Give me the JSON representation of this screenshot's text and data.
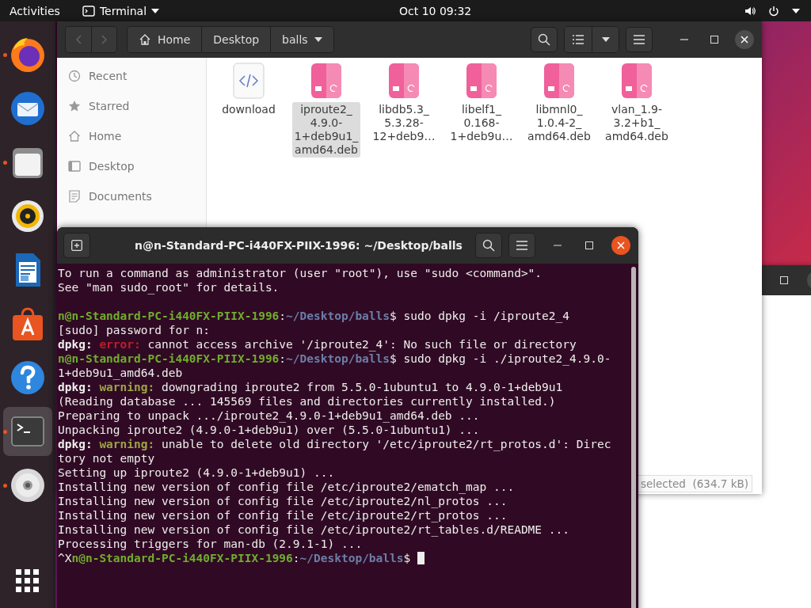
{
  "top_bar": {
    "activities": "Activities",
    "app_menu": "Terminal",
    "clock": "Oct 10  09:32"
  },
  "dock": {
    "items": [
      {
        "kind": "browser",
        "running": true,
        "active": false
      },
      {
        "kind": "mail",
        "running": false,
        "active": false
      },
      {
        "kind": "files",
        "running": true,
        "active": false
      },
      {
        "kind": "music",
        "running": false,
        "active": false
      },
      {
        "kind": "document",
        "running": false,
        "active": false
      },
      {
        "kind": "store",
        "running": false,
        "active": false
      },
      {
        "kind": "help",
        "running": false,
        "active": false
      },
      {
        "kind": "terminal",
        "running": true,
        "active": true
      },
      {
        "kind": "disc",
        "running": true,
        "active": false
      }
    ]
  },
  "files_window": {
    "nav": {
      "back_disabled": true,
      "forward_disabled": true
    },
    "path": [
      {
        "label": "Home",
        "kind": "home",
        "dropdown": false
      },
      {
        "label": "Desktop",
        "kind": "folder",
        "dropdown": false
      },
      {
        "label": "balls",
        "kind": "folder",
        "dropdown": true
      }
    ],
    "sidebar": [
      {
        "label": "Recent",
        "kind": "recent"
      },
      {
        "label": "Starred",
        "kind": "starred"
      },
      {
        "label": "Home",
        "kind": "home"
      },
      {
        "label": "Desktop",
        "kind": "desktop"
      },
      {
        "label": "Documents",
        "kind": "documents"
      }
    ],
    "files": [
      {
        "name": "download",
        "kind": "html",
        "selected": false
      },
      {
        "name": "iproute2_\n4.9.0-\n1+deb9u1_\namd64.deb",
        "kind": "deb",
        "selected": true
      },
      {
        "name": "libdb5.3_\n5.3.28-\n12+deb9…",
        "kind": "deb",
        "selected": false
      },
      {
        "name": "libelf1_\n0.168-\n1+deb9u…",
        "kind": "deb",
        "selected": false
      },
      {
        "name": "libmnl0_\n1.0.4-2_\namd64.deb",
        "kind": "deb",
        "selected": false
      },
      {
        "name": "vlan_1.9-\n3.2+b1_\namd64.deb",
        "kind": "deb",
        "selected": false
      }
    ],
    "status": "selected  (634.7 kB)"
  },
  "terminal_window": {
    "title": "n@n-Standard-PC-i440FX-PIIX-1996: ~/Desktop/balls",
    "cursor": true,
    "lines": [
      {
        "kind": "text",
        "segments": [
          {
            "kind": "plain",
            "text": "To run a command as administrator (user \"root\"), use \"sudo <command>\"."
          }
        ]
      },
      {
        "kind": "text",
        "segments": [
          {
            "kind": "plain",
            "text": "See \"man sudo_root\" for details."
          }
        ]
      },
      {
        "kind": "blank"
      },
      {
        "kind": "text",
        "segments": [
          {
            "kind": "prompt",
            "text": "n@n-Standard-PC-i440FX-PIIX-1996"
          },
          {
            "kind": "plain",
            "text": ":"
          },
          {
            "kind": "path",
            "text": "~/Desktop/balls"
          },
          {
            "kind": "plain",
            "text": "$ sudo dpkg -i /iproute2_4"
          }
        ]
      },
      {
        "kind": "text",
        "segments": [
          {
            "kind": "plain",
            "text": "[sudo] password for n:"
          }
        ]
      },
      {
        "kind": "text",
        "segments": [
          {
            "kind": "bold",
            "text": "dpkg:"
          },
          {
            "kind": "error",
            "text": " error:"
          },
          {
            "kind": "plain",
            "text": " cannot access archive '/iproute2_4': No such file or directory"
          }
        ]
      },
      {
        "kind": "text",
        "segments": [
          {
            "kind": "prompt",
            "text": "n@n-Standard-PC-i440FX-PIIX-1996"
          },
          {
            "kind": "plain",
            "text": ":"
          },
          {
            "kind": "path",
            "text": "~/Desktop/balls"
          },
          {
            "kind": "plain",
            "text": "$ sudo dpkg -i ./iproute2_4.9.0-"
          }
        ]
      },
      {
        "kind": "text",
        "segments": [
          {
            "kind": "plain",
            "text": "1+deb9u1_amd64.deb"
          }
        ]
      },
      {
        "kind": "text",
        "segments": [
          {
            "kind": "bold",
            "text": "dpkg:"
          },
          {
            "kind": "warning",
            "text": " warning:"
          },
          {
            "kind": "plain",
            "text": " downgrading iproute2 from 5.5.0-1ubuntu1 to 4.9.0-1+deb9u1"
          }
        ]
      },
      {
        "kind": "text",
        "segments": [
          {
            "kind": "plain",
            "text": "(Reading database ... 145569 files and directories currently installed.)"
          }
        ]
      },
      {
        "kind": "text",
        "segments": [
          {
            "kind": "plain",
            "text": "Preparing to unpack .../iproute2_4.9.0-1+deb9u1_amd64.deb ..."
          }
        ]
      },
      {
        "kind": "text",
        "segments": [
          {
            "kind": "plain",
            "text": "Unpacking iproute2 (4.9.0-1+deb9u1) over (5.5.0-1ubuntu1) ..."
          }
        ]
      },
      {
        "kind": "text",
        "segments": [
          {
            "kind": "bold",
            "text": "dpkg:"
          },
          {
            "kind": "warning",
            "text": " warning:"
          },
          {
            "kind": "plain",
            "text": " unable to delete old directory '/etc/iproute2/rt_protos.d': Direc"
          }
        ]
      },
      {
        "kind": "text",
        "segments": [
          {
            "kind": "plain",
            "text": "tory not empty"
          }
        ]
      },
      {
        "kind": "text",
        "segments": [
          {
            "kind": "plain",
            "text": "Setting up iproute2 (4.9.0-1+deb9u1) ..."
          }
        ]
      },
      {
        "kind": "text",
        "segments": [
          {
            "kind": "plain",
            "text": "Installing new version of config file /etc/iproute2/ematch_map ..."
          }
        ]
      },
      {
        "kind": "text",
        "segments": [
          {
            "kind": "plain",
            "text": "Installing new version of config file /etc/iproute2/nl_protos ..."
          }
        ]
      },
      {
        "kind": "text",
        "segments": [
          {
            "kind": "plain",
            "text": "Installing new version of config file /etc/iproute2/rt_protos ..."
          }
        ]
      },
      {
        "kind": "text",
        "segments": [
          {
            "kind": "plain",
            "text": "Installing new version of config file /etc/iproute2/rt_tables.d/README ..."
          }
        ]
      },
      {
        "kind": "text",
        "segments": [
          {
            "kind": "plain",
            "text": "Processing triggers for man-db (2.9.1-1) ..."
          }
        ]
      },
      {
        "kind": "text",
        "segments": [
          {
            "kind": "plain",
            "text": "^X"
          },
          {
            "kind": "prompt",
            "text": "n@n-Standard-PC-i440FX-PIIX-1996"
          },
          {
            "kind": "plain",
            "text": ":"
          },
          {
            "kind": "path",
            "text": "~/Desktop/balls"
          },
          {
            "kind": "plain",
            "text": "$ "
          }
        ]
      }
    ]
  }
}
